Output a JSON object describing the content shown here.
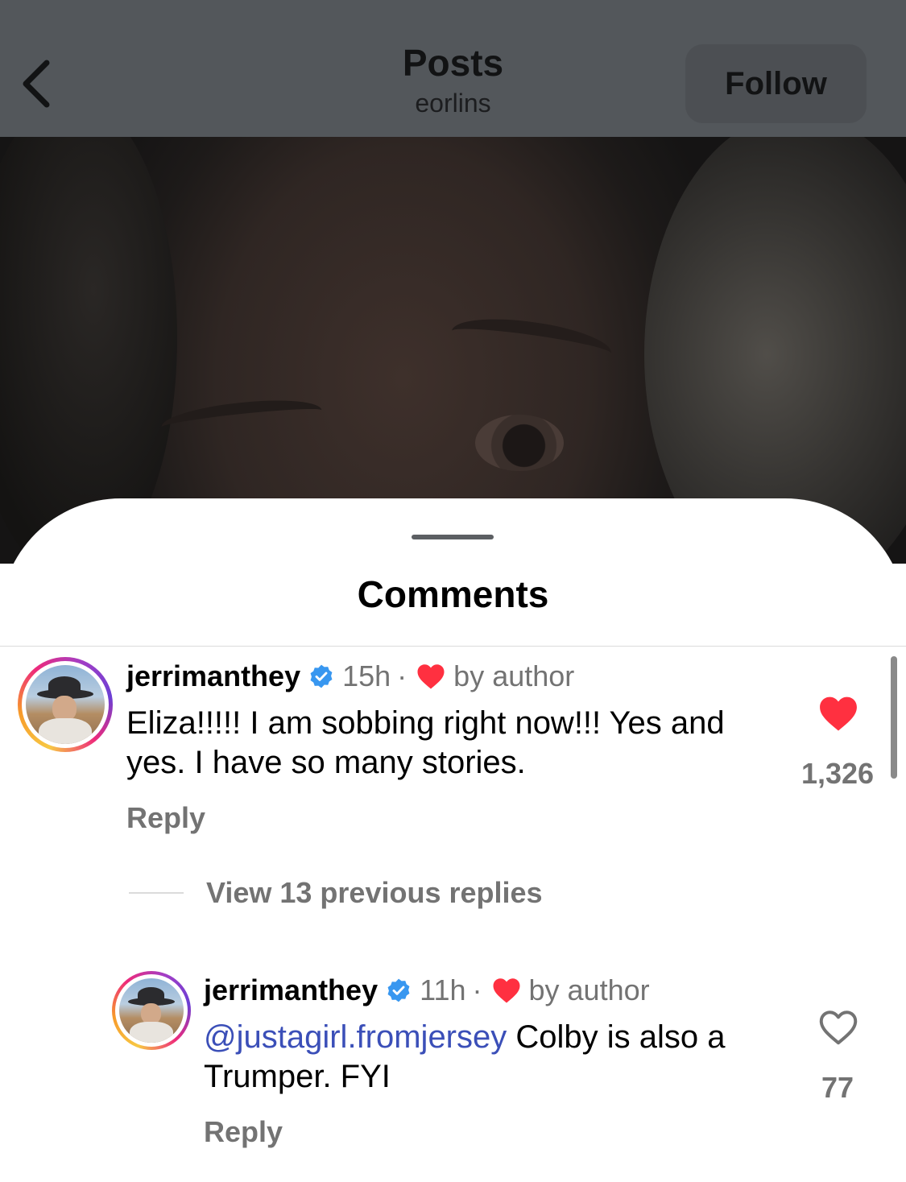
{
  "header": {
    "title": "Posts",
    "subtitle": "eorlins",
    "follow_label": "Follow"
  },
  "sheet": {
    "title": "Comments"
  },
  "comments": [
    {
      "username": "jerrimanthey",
      "time": "15h",
      "separator": "·",
      "badge": "by author",
      "text": "Eliza!!!!! I am sobbing right now!!! Yes and yes. I have so many stories.",
      "reply_label": "Reply",
      "like_count": "1,326",
      "liked": true
    }
  ],
  "view_replies": {
    "label": "View 13 previous replies"
  },
  "replies": [
    {
      "username": "jerrimanthey",
      "time": "11h",
      "separator": "·",
      "badge": "by author",
      "mention": "@justagirl.fromjersey",
      "text": " Colby is also a Trumper. FYI",
      "reply_label": "Reply",
      "like_count": "77",
      "liked": false
    }
  ],
  "colors": {
    "like_red": "#ff3040",
    "verified_blue": "#3897f0",
    "mention_blue": "#3b4fb8",
    "secondary_text": "#737373"
  },
  "icons": {
    "back": "chevron-left-icon",
    "verified": "verified-badge-icon",
    "heart_filled": "heart-filled-icon",
    "heart_outline": "heart-outline-icon"
  }
}
